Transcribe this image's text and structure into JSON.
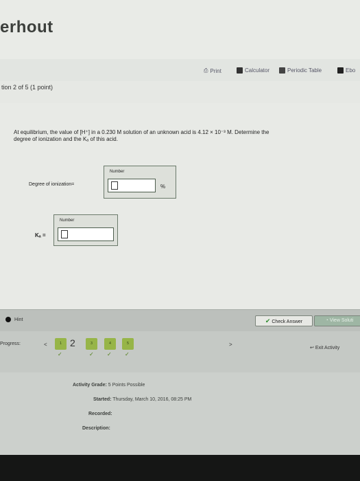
{
  "brand": "erhout",
  "toolbar": {
    "print": "Print",
    "calculator": "Calculator",
    "periodic_table": "Periodic Table",
    "ebook": "Ebo"
  },
  "question": {
    "header": "tion 2 of 5 (1 point)",
    "prompt_line1": "At equilibrium, the value of [H⁺] in a 0.230  M solution of an unknown acid is 4.12 × 10⁻³  M. Determine the",
    "prompt_line2": "degree of ionization and the Kₐ of this acid."
  },
  "answer_fields": {
    "degree": {
      "label": "Degree of ionization=",
      "box_title": "Number",
      "unit": "%"
    },
    "ka": {
      "label": "Kₐ =",
      "box_title": "Number"
    }
  },
  "footer": {
    "hint": "Hint",
    "check_answer": "Check Answer",
    "view_solution": "View Soluti"
  },
  "progress": {
    "label": "Progress:",
    "left_arrow": "<",
    "right_arrow": ">",
    "current": "2",
    "steps": [
      "1",
      "3",
      "4",
      "5"
    ],
    "exit": "Exit Activity",
    "check": "✓"
  },
  "activity": {
    "grade_label": "Activity Grade:",
    "grade_value": "5 Points Possible",
    "started_label": "Started:",
    "started_value": "Thursday, March 10, 2016, 08:25 PM",
    "recorded_label": "Recorded:",
    "description_label": "Description:"
  },
  "colors": {
    "step_green": "#97b548",
    "check_green": "#4e7d15",
    "dark": "#151615"
  }
}
